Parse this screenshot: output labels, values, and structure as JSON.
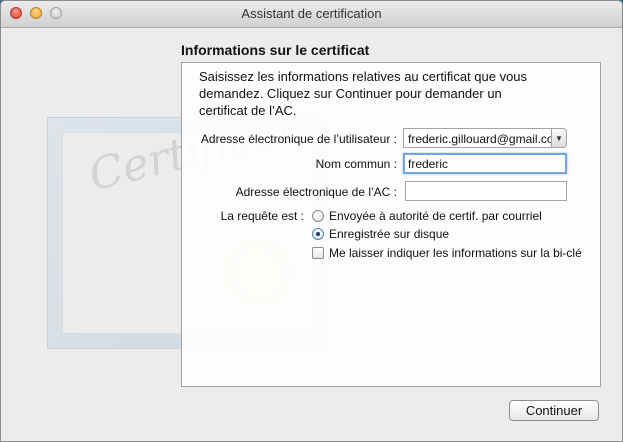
{
  "window": {
    "title": "Assistant de certification"
  },
  "background": {
    "certificate_word": "Certificate"
  },
  "page": {
    "heading": "Informations sur le certificat",
    "intro_line1": "Saisissez les informations relatives au certificat que vous",
    "intro_line2": "demandez. Cliquez sur Continuer pour demander un",
    "intro_line3": "certificat de l’AC."
  },
  "form": {
    "user_email_label": "Adresse électronique de l’utilisateur :",
    "user_email_value": "frederic.gillouard@gmail.com",
    "common_name_label": "Nom commun :",
    "common_name_value": "frederic",
    "ca_email_label": "Adresse électronique de l’AC :",
    "ca_email_value": "",
    "request_label": "La requête est :",
    "options": {
      "emailed": "Envoyée à autorité de certif. par courriel",
      "saved_to_disk": "Enregistrée sur disque",
      "selected": "saved_to_disk"
    },
    "keypair_checkbox": "Me laisser indiquer les informations sur la bi-clé",
    "keypair_checked": false
  },
  "buttons": {
    "continue": "Continuer"
  },
  "icons": {
    "dropdown": "chevron-down-icon"
  }
}
